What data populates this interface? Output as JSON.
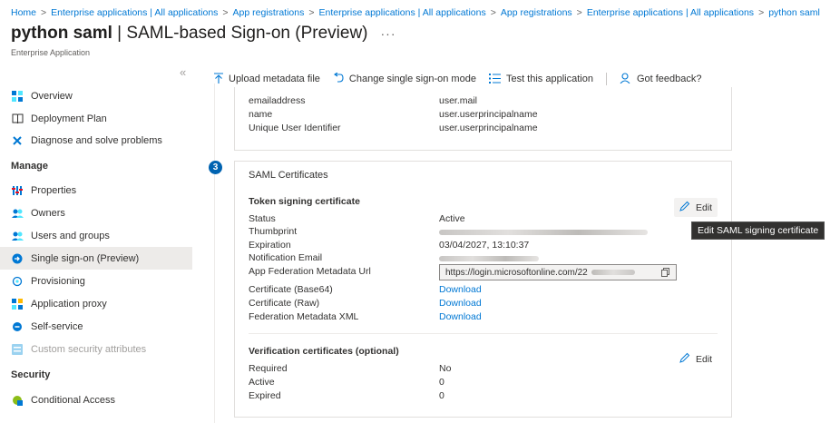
{
  "breadcrumb": {
    "items": [
      "Home",
      "Enterprise applications | All applications",
      "App registrations",
      "Enterprise applications | All applications",
      "App registrations",
      "Enterprise applications | All applications",
      "python saml"
    ],
    "separator": ">"
  },
  "header": {
    "app_name": "python saml",
    "page_name": " | SAML-based Sign-on (Preview)",
    "ellipsis": "···",
    "subtitle": "Enterprise Application"
  },
  "sidebar": {
    "collapse_glyph": "«",
    "items": [
      {
        "label": "Overview",
        "icon": "grid-icon"
      },
      {
        "label": "Deployment Plan",
        "icon": "book-icon"
      },
      {
        "label": "Diagnose and solve problems",
        "icon": "wrench-icon"
      }
    ],
    "manage_header": "Manage",
    "manage_items": [
      {
        "label": "Properties",
        "icon": "properties-icon"
      },
      {
        "label": "Owners",
        "icon": "owners-icon"
      },
      {
        "label": "Users and groups",
        "icon": "users-icon"
      },
      {
        "label": "Single sign-on (Preview)",
        "icon": "sso-icon"
      },
      {
        "label": "Provisioning",
        "icon": "provisioning-icon"
      },
      {
        "label": "Application proxy",
        "icon": "proxy-icon"
      },
      {
        "label": "Self-service",
        "icon": "self-service-icon"
      },
      {
        "label": "Custom security attributes",
        "icon": "attributes-icon"
      }
    ],
    "security_header": "Security",
    "security_items": [
      {
        "label": "Conditional Access",
        "icon": "conditional-access-icon"
      }
    ]
  },
  "toolbar": {
    "upload": "Upload metadata file",
    "change_mode": "Change single sign-on mode",
    "test": "Test this application",
    "feedback": "Got feedback?"
  },
  "attributes": [
    {
      "name": "emailaddress",
      "value": "user.mail"
    },
    {
      "name": "name",
      "value": "user.userprincipalname"
    },
    {
      "name": "Unique User Identifier",
      "value": "user.userprincipalname"
    }
  ],
  "saml_certificates": {
    "step": "3",
    "title": "SAML Certificates",
    "token_section": "Token signing certificate",
    "edit_label": "Edit",
    "tooltip": "Edit SAML signing certificate",
    "status_label": "Status",
    "status_value": "Active",
    "thumbprint_label": "Thumbprint",
    "expiration_label": "Expiration",
    "expiration_value": "03/04/2027, 13:10:37",
    "notification_label": "Notification Email",
    "metadata_url_label": "App Federation Metadata Url",
    "metadata_url_value": "https://login.microsoftonline.com/22",
    "cert_base64_label": "Certificate (Base64)",
    "cert_raw_label": "Certificate (Raw)",
    "fed_xml_label": "Federation Metadata XML",
    "download_label": "Download",
    "verification_section": "Verification certificates (optional)",
    "required_label": "Required",
    "required_value": "No",
    "active_label": "Active",
    "active_value": "0",
    "expired_label": "Expired",
    "expired_value": "0"
  }
}
